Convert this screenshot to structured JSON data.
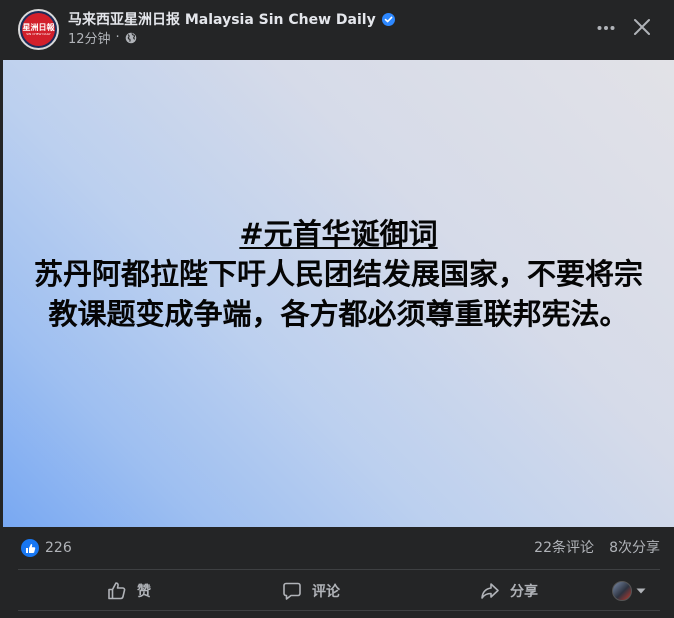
{
  "header": {
    "page_name": "马来西亚星洲日报 Malaysia Sin Chew Daily",
    "timestamp": "12分钟",
    "separator": "·",
    "avatar": {
      "logo_text": "星洲日報",
      "logo_subtext": "SIN CHEW DAILY"
    },
    "icons": {
      "verified": "verified-badge-icon",
      "privacy": "globe-icon",
      "more": "more-horizontal-icon",
      "close": "close-icon"
    }
  },
  "post": {
    "hashtag": "#元首华诞御词",
    "body": "苏丹阿都拉陛下吁人民团结发展国家，不要将宗教课题变成争端，各方都必须尊重联邦宪法。"
  },
  "stats": {
    "likes": "226",
    "comments": "22条评论",
    "shares": "8次分享"
  },
  "actions": {
    "like_label": "赞",
    "comment_label": "评论",
    "share_label": "分享"
  },
  "colors": {
    "background": "#242526",
    "accent": "#1877f2",
    "verified": "#2d88ff",
    "text_primary": "#e4e6eb",
    "text_secondary": "#b0b3b8"
  }
}
